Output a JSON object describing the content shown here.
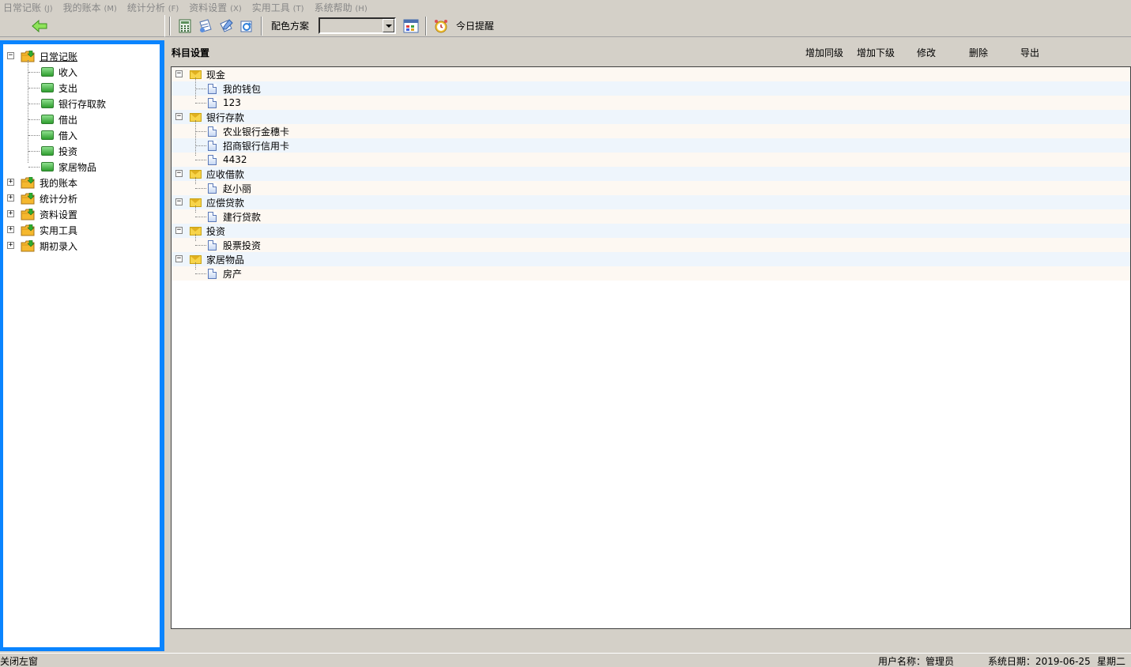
{
  "menu": [
    {
      "label": "日常记账",
      "hotkey": "(J)"
    },
    {
      "label": "我的账本",
      "hotkey": "(M)"
    },
    {
      "label": "统计分析",
      "hotkey": "(F)"
    },
    {
      "label": "资料设置",
      "hotkey": "(X)"
    },
    {
      "label": "实用工具",
      "hotkey": "(T)"
    },
    {
      "label": "系统帮助",
      "hotkey": "(H)"
    }
  ],
  "toolbar": {
    "color_scheme_label": "配色方案",
    "color_scheme_value": "",
    "reminder_label": "今日提醒"
  },
  "nav": {
    "groups": [
      {
        "label": "日常记账",
        "expanded": true,
        "children": [
          "收入",
          "支出",
          "银行存取款",
          "借出",
          "借入",
          "投资",
          "家居物品"
        ]
      },
      {
        "label": "我的账本",
        "expanded": false
      },
      {
        "label": "统计分析",
        "expanded": false
      },
      {
        "label": "资料设置",
        "expanded": false
      },
      {
        "label": "实用工具",
        "expanded": false
      },
      {
        "label": "期初录入",
        "expanded": false
      }
    ]
  },
  "main": {
    "title": "科目设置",
    "actions": [
      "增加同级",
      "增加下级",
      "修改",
      "删除",
      "导出"
    ],
    "tree": [
      {
        "label": "现金",
        "children": [
          "我的钱包",
          "123"
        ]
      },
      {
        "label": "银行存款",
        "children": [
          "农业银行金穗卡",
          "招商银行信用卡",
          "4432"
        ]
      },
      {
        "label": "应收借款",
        "children": [
          "赵小丽"
        ]
      },
      {
        "label": "应偿贷款",
        "children": [
          "建行贷款"
        ]
      },
      {
        "label": "投资",
        "children": [
          "股票投资"
        ]
      },
      {
        "label": "家居物品",
        "children": [
          "房产"
        ]
      }
    ]
  },
  "status": {
    "close_left": "关闭左窗",
    "user": "用户名称：管理员",
    "date": "系统日期：2019-06-25",
    "weekday": "星期二"
  },
  "colors": {
    "panel_border": "#0a84ff",
    "row_odd": "#fdf8f2",
    "row_even": "#eef5fc"
  }
}
